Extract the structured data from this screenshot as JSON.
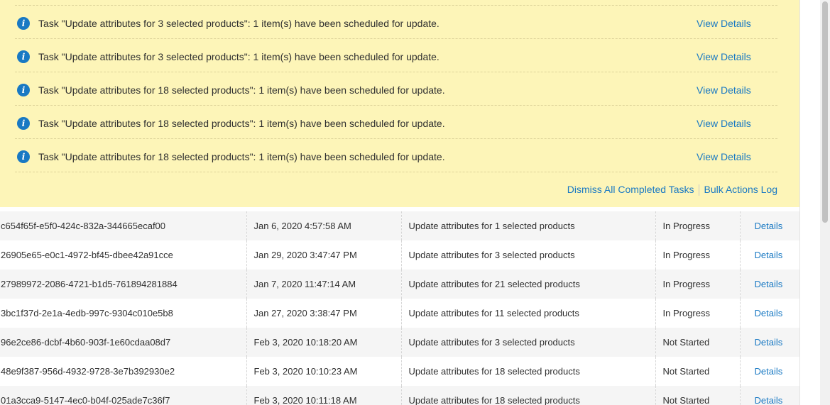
{
  "notifications": {
    "items": [
      {
        "icon": "info-icon",
        "text": "Task \"Update attributes for 3 selected products\": 1 item(s) have been scheduled for update.",
        "link": "View Details"
      },
      {
        "icon": "info-icon",
        "text": "Task \"Update attributes for 3 selected products\": 1 item(s) have been scheduled for update.",
        "link": "View Details"
      },
      {
        "icon": "info-icon",
        "text": "Task \"Update attributes for 18 selected products\": 1 item(s) have been scheduled for update.",
        "link": "View Details"
      },
      {
        "icon": "info-icon",
        "text": "Task \"Update attributes for 18 selected products\": 1 item(s) have been scheduled for update.",
        "link": "View Details"
      },
      {
        "icon": "info-icon",
        "text": "Task \"Update attributes for 18 selected products\": 1 item(s) have been scheduled for update.",
        "link": "View Details"
      }
    ],
    "dismiss_label": "Dismiss All Completed Tasks",
    "log_label": "Bulk Actions Log"
  },
  "table": {
    "rows": [
      {
        "id": "c654f65f-e5f0-424c-832a-344665ecaf00",
        "date": "Jan 6, 2020 4:57:58 AM",
        "description": "Update attributes for 1 selected products",
        "status": "In Progress",
        "action": "Details"
      },
      {
        "id": "26905e65-e0c1-4972-bf45-dbee42a91cce",
        "date": "Jan 29, 2020 3:47:47 PM",
        "description": "Update attributes for 3 selected products",
        "status": "In Progress",
        "action": "Details"
      },
      {
        "id": "27989972-2086-4721-b1d5-761894281884",
        "date": "Jan 7, 2020 11:47:14 AM",
        "description": "Update attributes for 21 selected products",
        "status": "In Progress",
        "action": "Details"
      },
      {
        "id": "3bc1f37d-2e1a-4edb-997c-9304c010e5b8",
        "date": "Jan 27, 2020 3:38:47 PM",
        "description": "Update attributes for 11 selected products",
        "status": "In Progress",
        "action": "Details"
      },
      {
        "id": "96e2ce86-dcbf-4b60-903f-1e60cdaa08d7",
        "date": "Feb 3, 2020 10:18:20 AM",
        "description": "Update attributes for 3 selected products",
        "status": "Not Started",
        "action": "Details"
      },
      {
        "id": "48e9f387-956d-4932-9728-3e7b392930e2",
        "date": "Feb 3, 2020 10:10:23 AM",
        "description": "Update attributes for 18 selected products",
        "status": "Not Started",
        "action": "Details"
      },
      {
        "id": "01a3cca9-5147-4ec0-b04f-025ade7c36f7",
        "date": "Feb 3, 2020 10:11:18 AM",
        "description": "Update attributes for 18 selected products",
        "status": "Not Started",
        "action": "Details"
      }
    ]
  },
  "colors": {
    "notice_background": "#fdf5b8",
    "link": "#1979c3",
    "info_icon": "#1979c3"
  }
}
